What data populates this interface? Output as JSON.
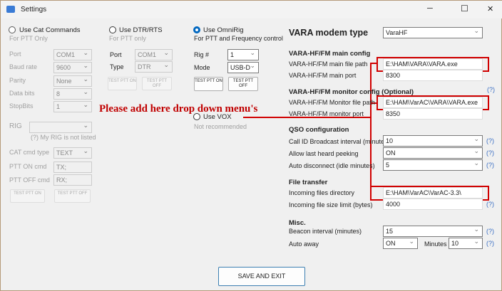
{
  "window": {
    "title": "Settings",
    "minimize": "─",
    "maximize": "☐",
    "close": "✕"
  },
  "cat": {
    "radio_label": "Use Cat Commands",
    "sub": "For PTT Only",
    "port_label": "Port",
    "port": "COM1",
    "baud_label": "Baud rate",
    "baud": "9600",
    "parity_label": "Parity",
    "parity": "None",
    "databits_label": "Data bits",
    "databits": "8",
    "stopbits_label": "StopBits",
    "stopbits": "1",
    "rig_label": "RIG",
    "rig": "",
    "rig_not_listed": "(?) My RIG is not listed",
    "cmdtype_label": "CAT cmd type",
    "cmdtype": "TEXT",
    "ptton_label": "PTT ON cmd",
    "ptton": "TX;",
    "pttoff_label": "PTT OFF cmd",
    "pttoff": "RX;",
    "test_on": "TEST PTT ON",
    "test_off": "TEST PTT OFF"
  },
  "dtr": {
    "radio_label": "Use DTR/RTS",
    "sub": "For PTT only",
    "port_label": "Port",
    "port": "COM1",
    "type_label": "Type",
    "type": "DTR",
    "test_on": "TEST PTT ON",
    "test_off": "TEST PTT OFF"
  },
  "omni": {
    "radio_label": "Use OmniRig",
    "sub": "For PTT and Frequency control",
    "rig_label": "Rig #",
    "rig": "1",
    "mode_label": "Mode",
    "mode": "USB-D",
    "test_on": "TEST PTT ON",
    "test_off": "TEST PTT OFF"
  },
  "vox": {
    "radio_label": "Use VOX",
    "sub": "Not recommended"
  },
  "annotation": "Please add here drop down menu's",
  "right": {
    "modem_label": "VARA modem type",
    "modem": "VaraHF",
    "main_heading": "VARA-HF/FM main config",
    "main_path_label": "VARA-HF/FM main file path",
    "main_path": "E:\\HAM\\VARA\\VARA.exe",
    "main_port_label": "VARA-HF/FM main port",
    "main_port": "8300",
    "mon_heading": "VARA-HF/FM monitor config (Optional)",
    "mon_path_label": "VARA-HF/FM Monitor file path",
    "mon_path": "E:\\HAM\\VarAC\\VARA\\VARA.exe",
    "mon_port_label": "VARA-HF/FM monitor port",
    "mon_port": "8350",
    "qso_heading": "QSO configuration",
    "callid_label": "Call ID Broadcast interval (minutes)",
    "callid": "10",
    "peek_label": "Allow last heard peeking",
    "peek": "ON",
    "autodisc_label": "Auto disconnect (idle minutes)",
    "autodisc": "5",
    "ft_heading": "File transfer",
    "incoming_label": "Incoming files directory",
    "incoming": "E:\\HAM\\VarAC\\VarAC-3.3\\",
    "sizelimit_label": "Incoming file size limit (bytes)",
    "sizelimit": "4000",
    "misc_heading": "Misc.",
    "beacon_label": "Beacon interval (minutes)",
    "beacon": "15",
    "autoaway_label": "Auto away",
    "autoaway": "ON",
    "minutes_label": "Minutes",
    "minutes": "10",
    "help": "(?)"
  },
  "save_label": "SAVE AND EXIT"
}
